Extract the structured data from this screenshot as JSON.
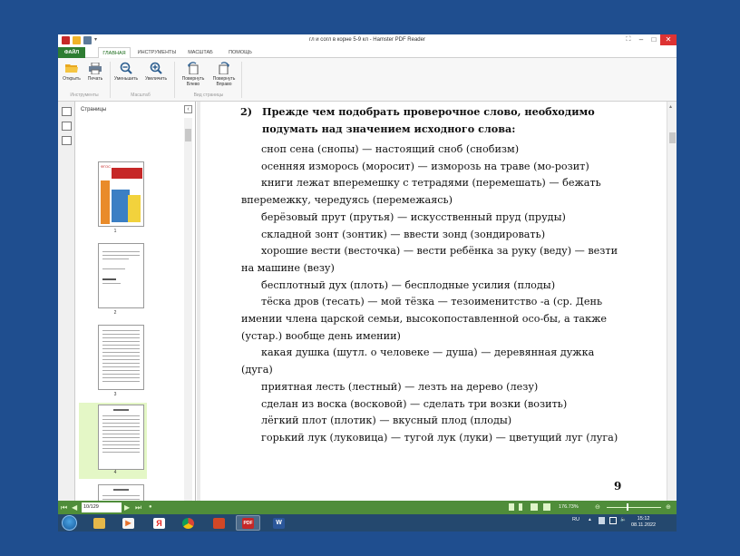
{
  "window": {
    "title": "гл и согл в корне 5-9 кл - Hamster PDF Reader",
    "controls": {
      "minimize": "–",
      "maximize": "□",
      "close": "✕"
    }
  },
  "ribbon_tabs": [
    "ФАЙЛ",
    "ГЛАВНАЯ",
    "ИНСТРУМЕНТЫ",
    "МАСШТАБ",
    "ПОМОЩЬ"
  ],
  "toolbar": {
    "open": "Открыть",
    "print": "Печать",
    "zoom_out": "Уменьшить",
    "zoom_in": "Увеличить",
    "rotate_left": [
      "Повернуть",
      "Влево"
    ],
    "rotate_right": [
      "Повернуть",
      "Вправо"
    ],
    "groups": {
      "tools": "Инструменты",
      "scale": "Масштаб",
      "view": "Вид страницы"
    }
  },
  "pages_panel": {
    "header": "Страницы",
    "thumbnails": [
      {
        "number": "1",
        "selected": false
      },
      {
        "number": "2",
        "selected": false
      },
      {
        "number": "3",
        "selected": false
      },
      {
        "number": "4",
        "selected": true
      }
    ]
  },
  "document": {
    "heading_number": "2)",
    "heading": "Прежде чем подобрать проверочное слово, необходимо подумать над значением исходного слова:",
    "paragraphs": [
      "сноп сена (снопы) — настоящий сноб (снобизм)",
      "осенняя изморось (моросит) — изморозь на траве (мо-розит)",
      "книги лежат вперемешку с тетрадями (перемешать) — бежать вперемежку, чередуясь (перемежаясь)",
      "берёзовый прут (прутья) — искусственный пруд (пруды)",
      "складной зонт (зонтик) — ввести зонд (зондировать)",
      "хорошие вести (весточка) — вести ребёнка за руку (веду) — везти на машине (везу)",
      "бесплотный дух (плоть) — бесплодные усилия (плоды)",
      "тёска дров (тесать) — мой тёзка — тезоименитство -а (ср. День имении члена царской семьи, высокопоставленной осо-бы, а также (устар.) вообще день имении)",
      "какая душка (шутл. о человеке — душа) — деревянная дужка (дуга)",
      "приятная лесть (лестный) — лезть на дерево (лезу)",
      "сделан из воска (восковой) — сделать три возки (возить)",
      "лёгкий плот (плотик) — вкусный плод (плоды)",
      "горький лук (луковица) — тугой лук (луки) — цветущий луг (луга)"
    ],
    "page_number": "9"
  },
  "status_bar": {
    "page_field": "10/129",
    "zoom": "176.73%"
  },
  "taskbar": {
    "language": "RU",
    "time": "15:12",
    "date": "08.11.2022",
    "pdf_label": "PDF"
  },
  "colors": {
    "file_tab": "#2e7d32",
    "status_bar": "#4f8d3a",
    "desktop": "#1f4e8f",
    "taskbar": "#24486e",
    "selected_thumb": "#e4f7c6"
  }
}
